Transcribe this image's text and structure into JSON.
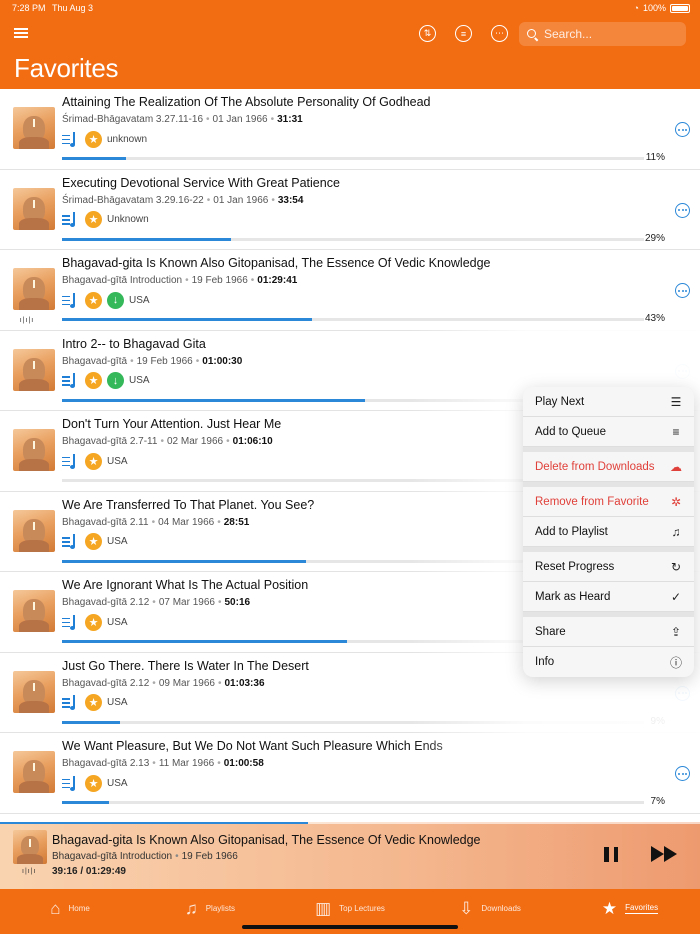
{
  "status": {
    "time": "7:28 PM",
    "date": "Thu Aug 3",
    "battery": "100%"
  },
  "header": {
    "title": "Favorites",
    "search_placeholder": "Search...",
    "sort_icon": "sort-icon",
    "filter_icon": "filter-icon",
    "more_icon": "ellipsis-icon"
  },
  "lectures": [
    {
      "title": "Attaining The Realization Of The Absolute Personality Of Godhead",
      "source": "Śrimad-Bhāgavatam 3.27.11-16",
      "date": "01 Jan 1966",
      "duration": "31:31",
      "place": "unknown",
      "downloaded": false,
      "playing": false,
      "progress": 11,
      "progress_label": "11%"
    },
    {
      "title": "Executing Devotional Service With Great Patience",
      "source": "Śrimad-Bhāgavatam 3.29.16-22",
      "date": "01 Jan 1966",
      "duration": "33:54",
      "place": "Unknown",
      "downloaded": false,
      "playing": false,
      "progress": 29,
      "progress_label": "29%"
    },
    {
      "title": "Bhagavad-gita Is Known Also Gitopanisad, The Essence Of Vedic Knowledge",
      "source": "Bhagavad-gītā Introduction",
      "date": "19 Feb 1966",
      "duration": "01:29:41",
      "place": "USA",
      "downloaded": true,
      "playing": true,
      "progress": 43,
      "progress_label": "43%"
    },
    {
      "title": "Intro 2-- to Bhagavad Gita",
      "source": "Bhagavad-gītā",
      "date": "19 Feb 1966",
      "duration": "01:00:30",
      "place": "USA",
      "downloaded": true,
      "playing": false,
      "progress": 52,
      "progress_label": ""
    },
    {
      "title": "Don't Turn Your Attention. Just Hear Me",
      "source": "Bhagavad-gītā 2.7-11",
      "date": "02 Mar 1966",
      "duration": "01:06:10",
      "place": "USA",
      "downloaded": false,
      "playing": false,
      "progress": 0,
      "progress_label": ""
    },
    {
      "title": "We Are Transferred To That Planet. You See?",
      "source": "Bhagavad-gītā 2.11",
      "date": "04 Mar 1966",
      "duration": "28:51",
      "place": "USA",
      "downloaded": false,
      "playing": false,
      "progress": 42,
      "progress_label": ""
    },
    {
      "title": "We Are Ignorant What Is The Actual Position",
      "source": "Bhagavad-gītā 2.12",
      "date": "07 Mar 1966",
      "duration": "50:16",
      "place": "USA",
      "downloaded": false,
      "playing": false,
      "progress": 49,
      "progress_label": ""
    },
    {
      "title": "Just Go There. There Is Water In The Desert",
      "source": "Bhagavad-gītā 2.12",
      "date": "09 Mar 1966",
      "duration": "01:03:36",
      "place": "USA",
      "downloaded": false,
      "playing": false,
      "progress": 10,
      "progress_label": "9%"
    },
    {
      "title": "We Want Pleasure, But We Do Not Want Such Pleasure Which Ends",
      "source": "Bhagavad-gītā 2.13",
      "date": "11 Mar 1966",
      "duration": "01:00:58",
      "place": "USA",
      "downloaded": false,
      "playing": false,
      "progress": 8,
      "progress_label": "7%"
    }
  ],
  "context_menu": {
    "groups": [
      [
        {
          "label": "Play Next",
          "icon": "play-next-icon",
          "glyph": "☰",
          "danger": false
        },
        {
          "label": "Add to Queue",
          "icon": "add-to-queue-icon",
          "glyph": "≡",
          "danger": false
        }
      ],
      [
        {
          "label": "Delete from Downloads",
          "icon": "cloud-slash-icon",
          "glyph": "☁",
          "danger": true
        }
      ],
      [
        {
          "label": "Remove from Favorite",
          "icon": "star-slash-icon",
          "glyph": "✲",
          "danger": true
        },
        {
          "label": "Add to Playlist",
          "icon": "playlist-add-icon",
          "glyph": "♫",
          "danger": false
        }
      ],
      [
        {
          "label": "Reset Progress",
          "icon": "reset-icon",
          "glyph": "↻",
          "danger": false
        },
        {
          "label": "Mark as Heard",
          "icon": "checkmark-icon",
          "glyph": "✓",
          "danger": false
        }
      ],
      [
        {
          "label": "Share",
          "icon": "share-icon",
          "glyph": "⇪",
          "danger": false
        },
        {
          "label": "Info",
          "icon": "info-icon",
          "glyph": "ⓘ",
          "danger": false
        }
      ]
    ]
  },
  "now_playing": {
    "title": "Bhagavad-gita Is Known Also Gitopanisad, The Essence Of Vedic Knowledge",
    "source": "Bhagavad-gītā Introduction",
    "date": "19 Feb 1966",
    "time": "39:16 / 01:29:49",
    "progress": 44
  },
  "tabs": [
    {
      "label": "Home",
      "icon": "home-icon",
      "glyph": "⌂",
      "active": false
    },
    {
      "label": "Playlists",
      "icon": "playlists-icon",
      "glyph": "♫",
      "active": false
    },
    {
      "label": "Top Lectures",
      "icon": "bar-chart-icon",
      "glyph": "▥",
      "active": false
    },
    {
      "label": "Downloads",
      "icon": "download-icon",
      "glyph": "⇩",
      "active": false
    },
    {
      "label": "Favorites",
      "icon": "star-icon",
      "glyph": "★",
      "active": true
    }
  ],
  "colors": {
    "accent": "#f26c12",
    "progress": "#2b88d8",
    "star": "#f5a623",
    "download": "#35b85a",
    "danger": "#e0403a"
  }
}
